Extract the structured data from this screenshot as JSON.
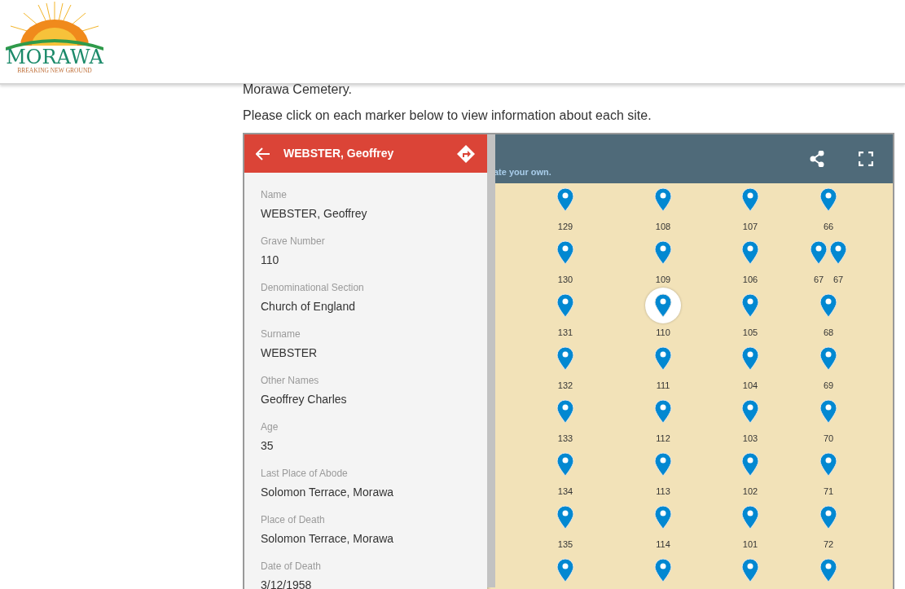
{
  "logo": {
    "name": "MORAWA",
    "tagline": "BREAKING NEW GROUND"
  },
  "intro": [
    "Morawa Cemetery.",
    "Please click on each marker below to view information about each site."
  ],
  "map": {
    "header_text": "ate your own.",
    "panel": {
      "title": "WEBSTER, Geoffrey",
      "fields": [
        {
          "label": "Name",
          "value": "WEBSTER, Geoffrey"
        },
        {
          "label": "Grave Number",
          "value": "110"
        },
        {
          "label": "Denominational Section",
          "value": "Church of England"
        },
        {
          "label": "Surname",
          "value": "WEBSTER"
        },
        {
          "label": "Other Names",
          "value": "Geoffrey Charles"
        },
        {
          "label": "Age",
          "value": "35"
        },
        {
          "label": "Last Place of Abode",
          "value": "Solomon Terrace, Morawa"
        },
        {
          "label": "Place of Death",
          "value": "Solomon Terrace, Morawa"
        },
        {
          "label": "Date of Death",
          "value": "3/12/1958"
        }
      ]
    },
    "marker_rows": [
      {
        "cells": [
          {
            "pins": [
              {
                "label": "129",
                "selected": false
              }
            ]
          },
          {
            "pins": [
              {
                "label": "108",
                "selected": false
              }
            ]
          },
          {
            "pins": [
              {
                "label": "107",
                "selected": false
              }
            ]
          },
          {
            "pins": [
              {
                "label": "66",
                "selected": false
              }
            ]
          }
        ]
      },
      {
        "cells": [
          {
            "pins": [
              {
                "label": "130",
                "selected": false
              }
            ]
          },
          {
            "pins": [
              {
                "label": "109",
                "selected": false
              }
            ]
          },
          {
            "pins": [
              {
                "label": "106",
                "selected": false
              }
            ]
          },
          {
            "pins": [
              {
                "label": "67",
                "selected": false
              },
              {
                "label": "67",
                "selected": false
              }
            ]
          }
        ]
      },
      {
        "cells": [
          {
            "pins": [
              {
                "label": "131",
                "selected": false
              }
            ]
          },
          {
            "pins": [
              {
                "label": "110",
                "selected": true
              }
            ]
          },
          {
            "pins": [
              {
                "label": "105",
                "selected": false
              }
            ]
          },
          {
            "pins": [
              {
                "label": "68",
                "selected": false
              }
            ]
          }
        ]
      },
      {
        "cells": [
          {
            "pins": [
              {
                "label": "132",
                "selected": false
              }
            ]
          },
          {
            "pins": [
              {
                "label": "111",
                "selected": false
              }
            ]
          },
          {
            "pins": [
              {
                "label": "104",
                "selected": false
              }
            ]
          },
          {
            "pins": [
              {
                "label": "69",
                "selected": false
              }
            ]
          }
        ]
      },
      {
        "cells": [
          {
            "pins": [
              {
                "label": "133",
                "selected": false
              }
            ]
          },
          {
            "pins": [
              {
                "label": "112",
                "selected": false
              }
            ]
          },
          {
            "pins": [
              {
                "label": "103",
                "selected": false
              }
            ]
          },
          {
            "pins": [
              {
                "label": "70",
                "selected": false
              }
            ]
          }
        ]
      },
      {
        "cells": [
          {
            "pins": [
              {
                "label": "134",
                "selected": false
              }
            ]
          },
          {
            "pins": [
              {
                "label": "113",
                "selected": false
              }
            ]
          },
          {
            "pins": [
              {
                "label": "102",
                "selected": false
              }
            ]
          },
          {
            "pins": [
              {
                "label": "71",
                "selected": false
              }
            ]
          }
        ]
      },
      {
        "cells": [
          {
            "pins": [
              {
                "label": "135",
                "selected": false
              }
            ]
          },
          {
            "pins": [
              {
                "label": "114",
                "selected": false
              }
            ]
          },
          {
            "pins": [
              {
                "label": "101",
                "selected": false
              }
            ]
          },
          {
            "pins": [
              {
                "label": "72",
                "selected": false
              }
            ]
          }
        ]
      },
      {
        "cells": [
          {
            "pins": [
              {
                "selected": false
              }
            ]
          },
          {
            "pins": [
              {
                "selected": false
              }
            ]
          },
          {
            "pins": [
              {
                "selected": false
              }
            ]
          },
          {
            "pins": [
              {
                "selected": false
              }
            ]
          }
        ]
      }
    ]
  }
}
